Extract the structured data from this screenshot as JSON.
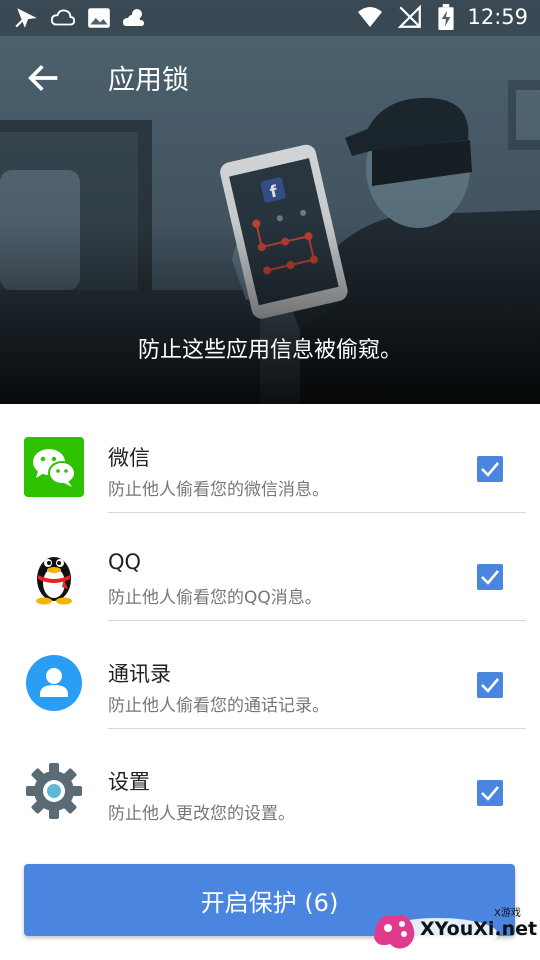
{
  "status_bar": {
    "time": "12:59",
    "left_icons": [
      "airplane-cursor-icon",
      "cloud-icon",
      "image-icon",
      "weather-icon"
    ],
    "right_icons": [
      "wifi-icon",
      "no-signal-icon",
      "battery-charging-icon"
    ]
  },
  "app_bar": {
    "title": "应用锁",
    "back_icon": "arrow-left-icon"
  },
  "hero": {
    "caption": "防止这些应用信息被偷窥。"
  },
  "apps": [
    {
      "name": "微信",
      "desc": "防止他人偷看您的微信消息。",
      "icon": "wechat-icon",
      "checked": true
    },
    {
      "name": "QQ",
      "desc": "防止他人偷看您的QQ消息。",
      "icon": "qq-penguin-icon",
      "checked": true
    },
    {
      "name": "通讯录",
      "desc": "防止他人偷看您的通话记录。",
      "icon": "contacts-icon",
      "checked": true
    },
    {
      "name": "设置",
      "desc": "防止他人更改您的设置。",
      "icon": "settings-gear-icon",
      "checked": true
    }
  ],
  "cta": {
    "label": "开启保护 (6)"
  },
  "watermark": {
    "brand": "XYouXi.net",
    "small": "X游戏"
  },
  "colors": {
    "accent": "#4a86e0",
    "hero_bg": "#4a5d6b",
    "wechat": "#2dc100",
    "contacts": "#2a9df4"
  }
}
